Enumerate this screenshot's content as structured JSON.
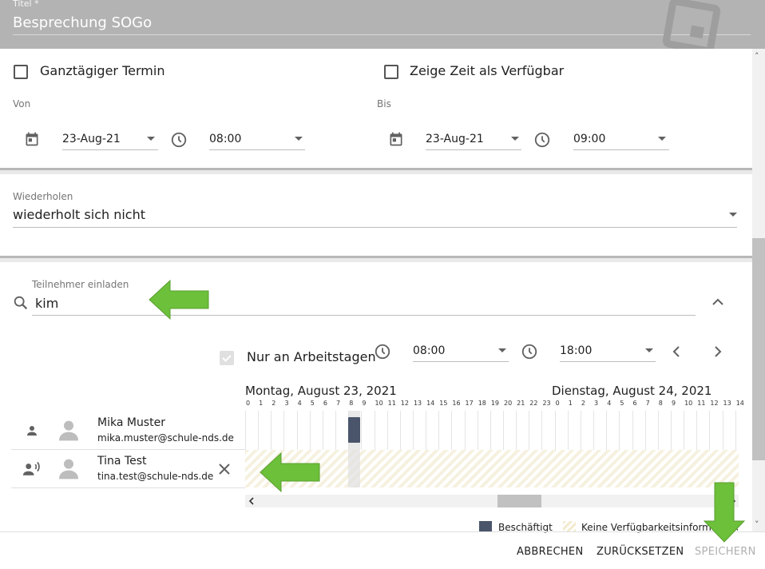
{
  "header": {
    "title_label": "Titel *",
    "title_value": "Besprechung SOGo",
    "bg_icon": "calendar-icon"
  },
  "options": {
    "all_day_label": "Ganztägiger Termin",
    "all_day_checked": false,
    "show_free_label": "Zeige Zeit als Verfügbar",
    "show_free_checked": false
  },
  "from": {
    "label": "Von",
    "date": "23-Aug-21",
    "time": "08:00"
  },
  "to": {
    "label": "Bis",
    "date": "23-Aug-21",
    "time": "09:00"
  },
  "repeat": {
    "label": "Wiederholen",
    "value": "wiederholt sich nicht"
  },
  "invite": {
    "label": "Teilnehmer einladen",
    "value": "kim"
  },
  "availability": {
    "workdays_label": "Nur an Arbeitstagen",
    "workdays_checked": true,
    "start_time": "08:00",
    "end_time": "18:00",
    "day1": "Montag, August 23, 2021",
    "day2": "Dienstag, August 24, 2021",
    "day1_hours": [
      "0",
      "1",
      "2",
      "3",
      "4",
      "5",
      "6",
      "7",
      "8",
      "9",
      "10",
      "11",
      "12",
      "13",
      "14",
      "15",
      "16",
      "17",
      "18",
      "19",
      "20",
      "21",
      "22",
      "23"
    ],
    "day2_hours": [
      "0",
      "1",
      "2",
      "3",
      "4",
      "5",
      "6",
      "7",
      "8",
      "9",
      "10",
      "11",
      "12",
      "13",
      "14"
    ]
  },
  "attendees": [
    {
      "name": "Mika Muster",
      "email": "mika.muster@schule-nds.de",
      "role_icon": "person-icon",
      "removable": false
    },
    {
      "name": "Tina Test",
      "email": "tina.test@schule-nds.de",
      "role_icon": "speaker-person-icon",
      "removable": true
    }
  ],
  "legend": {
    "busy": "Beschäftigt",
    "no_info": "Keine Verfügbarkeitsinformationen",
    "busy_color": "#4a556c"
  },
  "footer": {
    "cancel": "ABBRECHEN",
    "reset": "ZURÜCKSETZEN",
    "save": "SPEICHERN"
  },
  "colors": {
    "arrow": "#6cc03a",
    "header_bg": "#b3b3b3"
  }
}
